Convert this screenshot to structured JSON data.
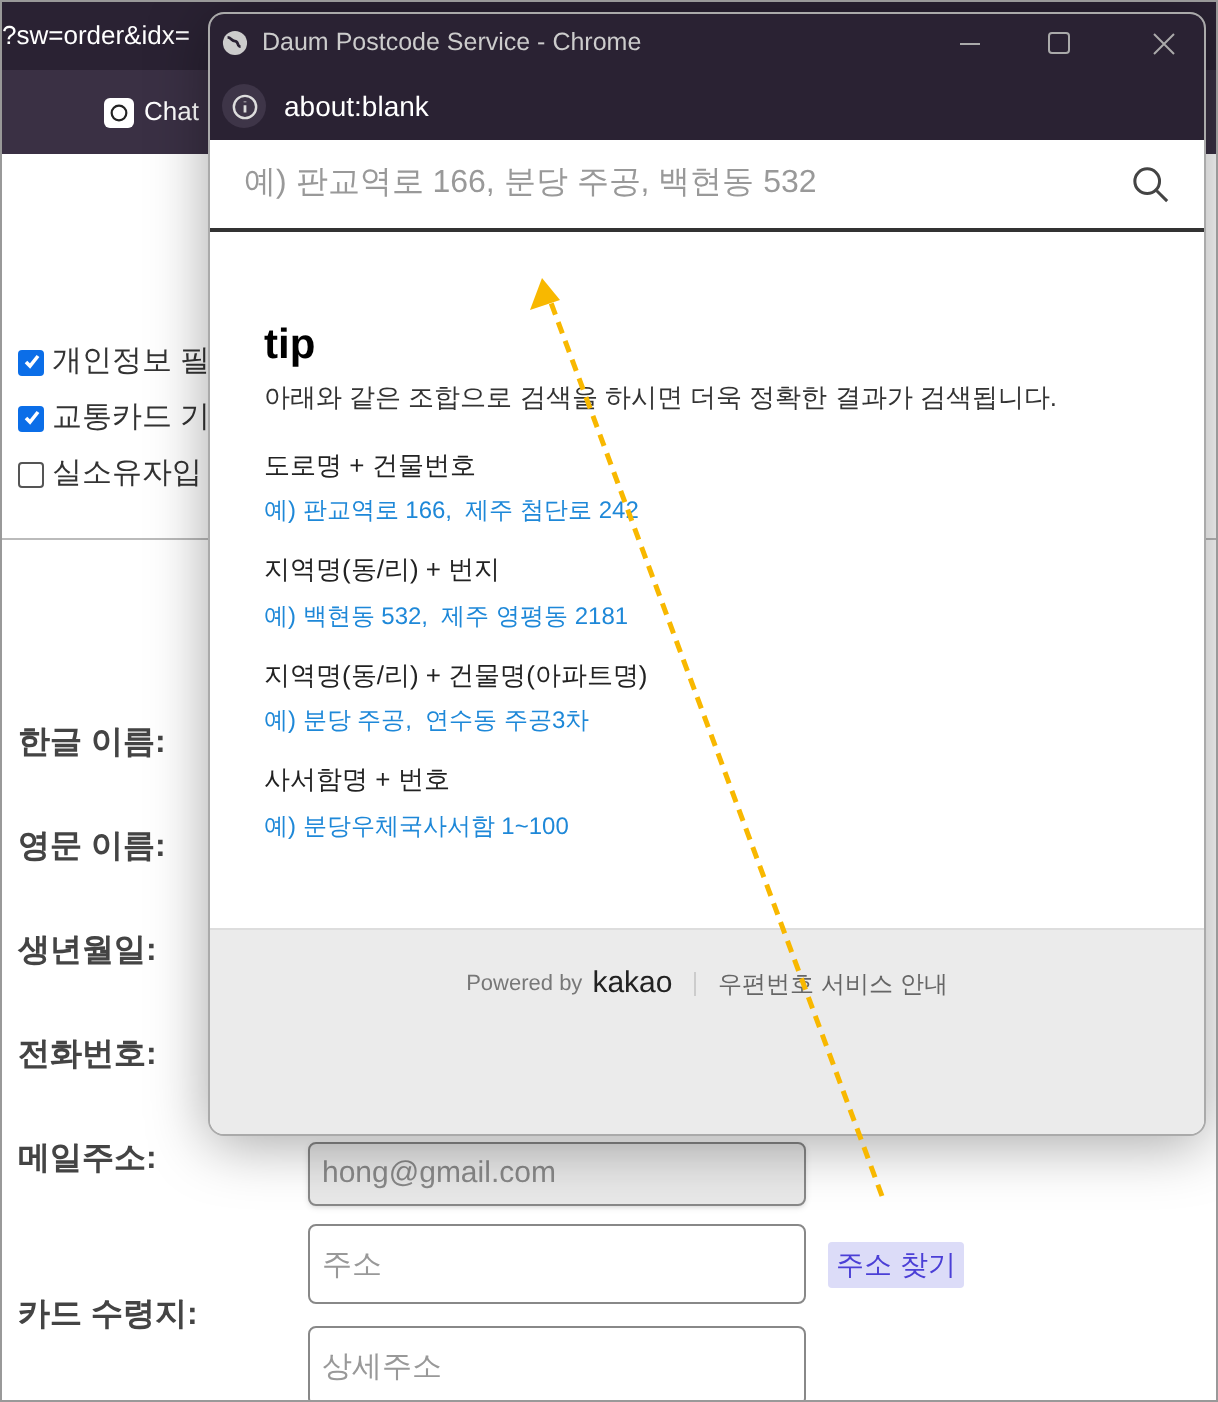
{
  "background_browser": {
    "url_fragment": "?sw=order&idx=",
    "bookmark": "Chat",
    "checkboxes": [
      {
        "label": "개인정보 필",
        "checked": true
      },
      {
        "label": "교통카드 기",
        "checked": true
      },
      {
        "label": "실소유자입",
        "checked": false
      }
    ],
    "form": [
      {
        "label": "한글 이름:",
        "kind": "none"
      },
      {
        "label": "영문 이름:",
        "kind": "none"
      },
      {
        "label": "생년월일:",
        "kind": "none"
      },
      {
        "label": "전화번호:",
        "kind": "none"
      },
      {
        "label": "메일주소:",
        "kind": "email",
        "value": "hong@gmail.com"
      },
      {
        "label": "카드 수령지:",
        "kind": "address",
        "placeholder": "주소",
        "button": "주소 찾기",
        "detail_placeholder": "상세주소"
      }
    ]
  },
  "popup": {
    "title": "Daum Postcode Service - Chrome",
    "address": "about:blank",
    "search": {
      "placeholder": "예) 판교역로 166, 분당 주공, 백현동 532"
    },
    "tip": {
      "heading": "tip",
      "intro": "아래와 같은 조합으로 검색을 하시면 더욱 정확한 결과가 검색됩니다.",
      "items": [
        {
          "label": "도로명 + 건물번호",
          "example": "예) 판교역로 166,  제주 첨단로 242"
        },
        {
          "label": "지역명(동/리) + 번지",
          "example": "예) 백현동 532,  제주 영평동 2181"
        },
        {
          "label": "지역명(동/리) + 건물명(아파트명)",
          "example": "예) 분당 주공,  연수동 주공3차"
        },
        {
          "label": "사서함명 + 번호",
          "example": "예) 분당우체국사서함 1~100"
        }
      ]
    },
    "footer": {
      "powered": "Powered by",
      "brand": "kakao",
      "link": "우편번호 서비스 안내"
    }
  }
}
